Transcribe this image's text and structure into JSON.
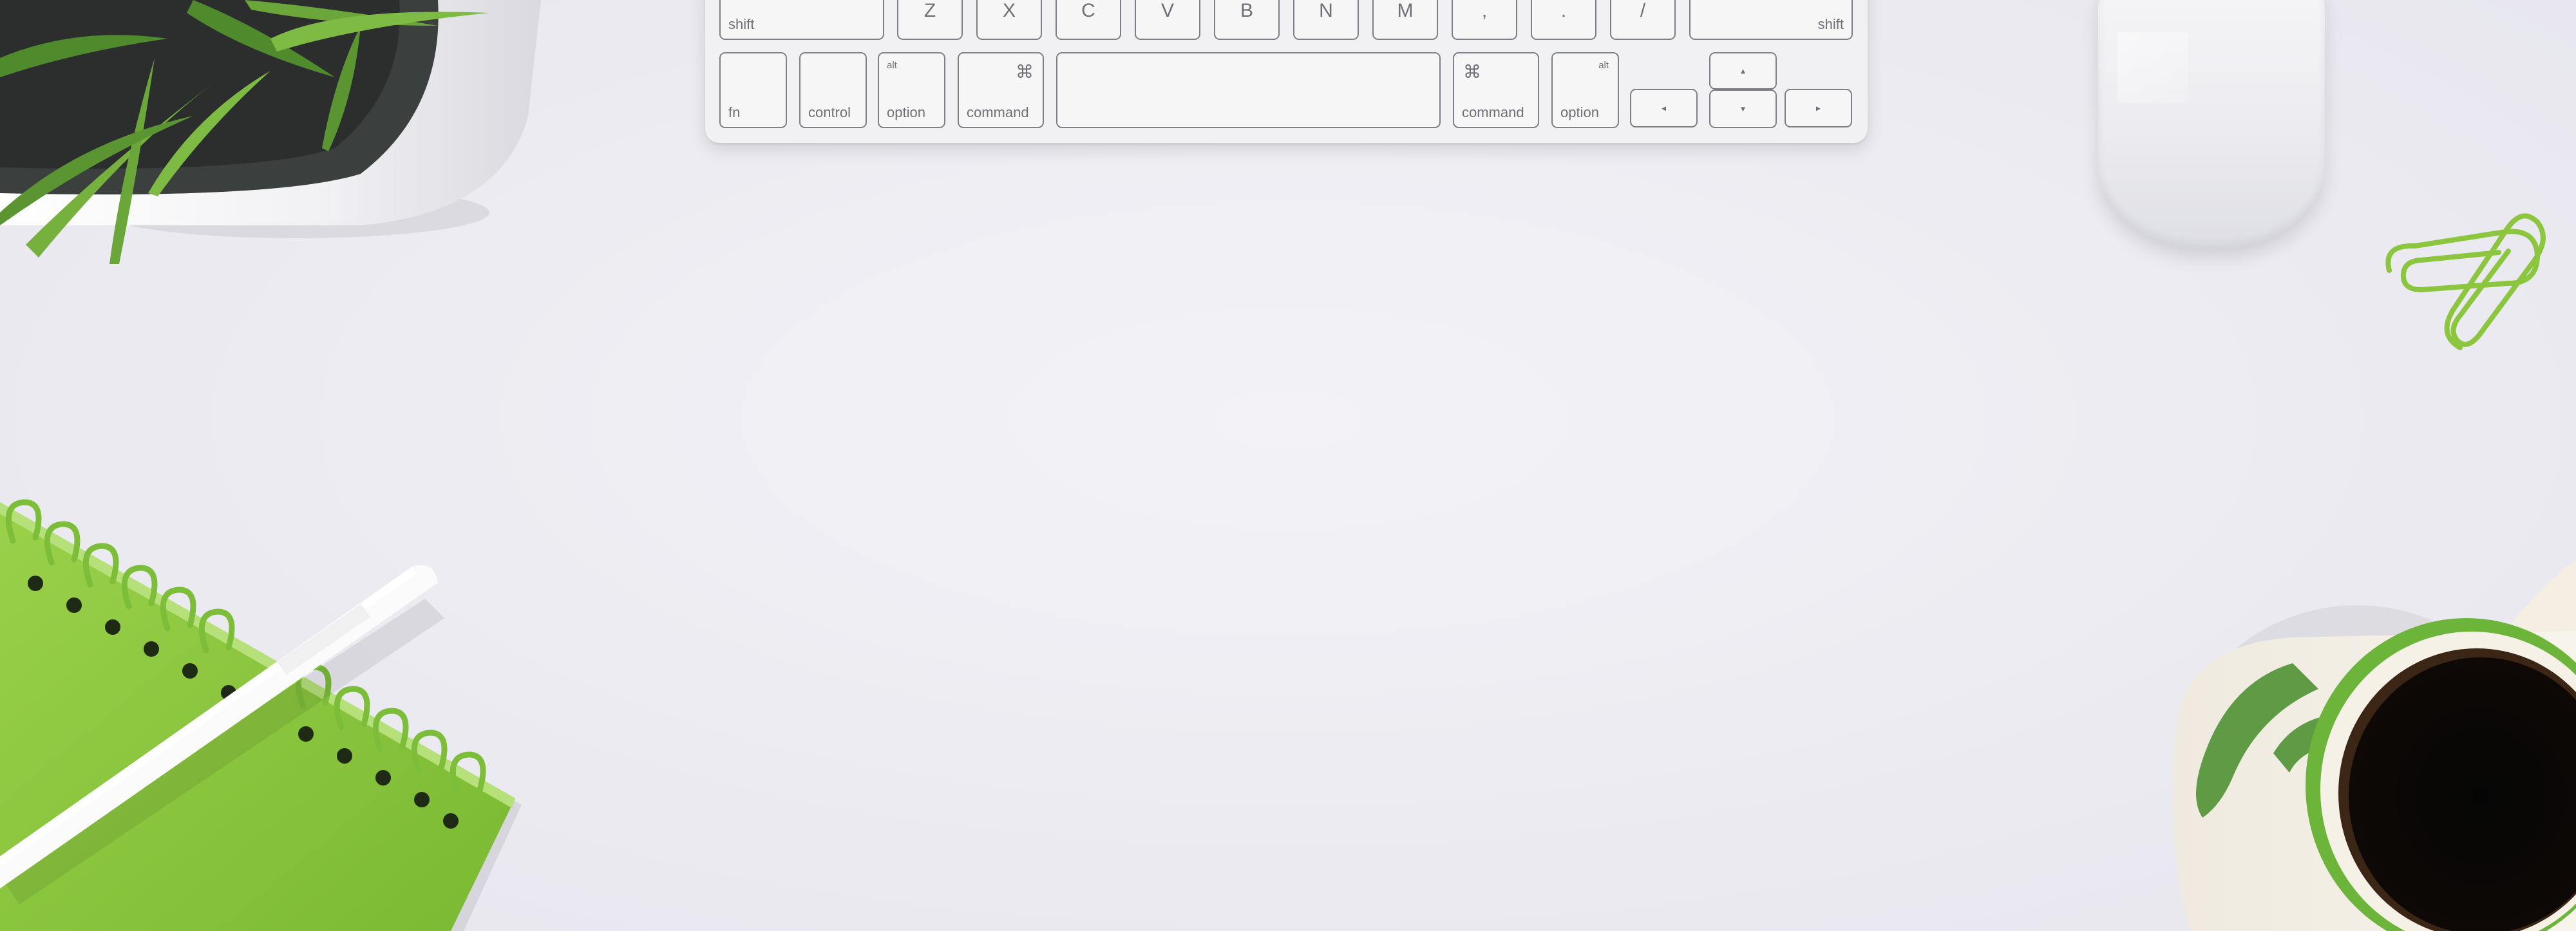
{
  "scene": {
    "background_color": "#eeeef3",
    "accent_green": "#8cc63f"
  },
  "keyboard": {
    "row1": {
      "shift_left": "shift",
      "letters": [
        "Z",
        "X",
        "C",
        "V",
        "B",
        "N",
        "M"
      ],
      "comma": ",",
      "period": ".",
      "slash": "/",
      "shift_right": "shift"
    },
    "row2": {
      "fn": "fn",
      "control": "control",
      "option_left": {
        "small": "alt",
        "label": "option"
      },
      "command_left": {
        "symbol": "⌘",
        "label": "command"
      },
      "command_right": {
        "symbol": "⌘",
        "label": "command"
      },
      "option_right": {
        "small": "alt",
        "label": "option"
      },
      "arrow_left": "◂",
      "arrow_up": "▴",
      "arrow_down": "▾",
      "arrow_right": "▸"
    }
  },
  "objects": [
    {
      "name": "potted-plant",
      "color": "#6aa63a"
    },
    {
      "name": "wireless-mouse",
      "color": "#f2f2f4"
    },
    {
      "name": "green-paper-clips",
      "color": "#8cc63f"
    },
    {
      "name": "spiral-notebook",
      "color": "#8cc63f"
    },
    {
      "name": "white-pen",
      "color": "#fafafa"
    },
    {
      "name": "coffee-mug",
      "color": "#f3efe4"
    }
  ]
}
